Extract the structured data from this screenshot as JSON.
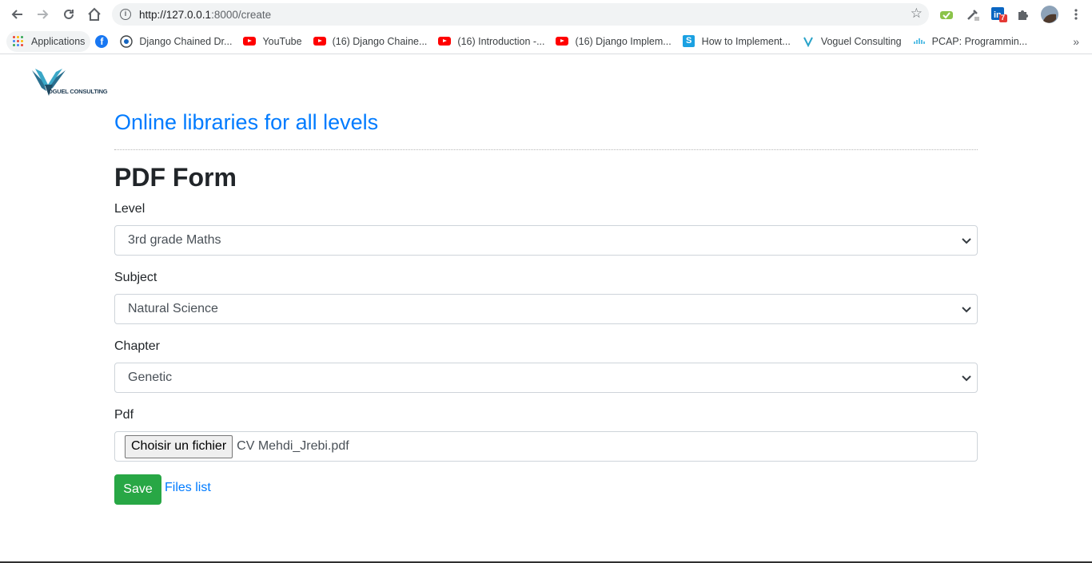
{
  "browser": {
    "url_host": "http://127.0.0.1",
    "url_path": ":8000/create",
    "linkedin_badge": "7",
    "bookmarks": [
      {
        "label": "Applications",
        "icon": "apps-grid-icon"
      },
      {
        "label": "",
        "icon": "facebook-icon"
      },
      {
        "label": "Django Chained Dr...",
        "icon": "django-icon"
      },
      {
        "label": "YouTube",
        "icon": "youtube-icon"
      },
      {
        "label": "(16) Django Chaine...",
        "icon": "youtube-icon"
      },
      {
        "label": "(16) Introduction -...",
        "icon": "youtube-icon"
      },
      {
        "label": "(16) Django Implem...",
        "icon": "youtube-icon"
      },
      {
        "label": "How to Implement...",
        "icon": "stackoverflow-icon"
      },
      {
        "label": "Voguel Consulting",
        "icon": "voguel-icon"
      },
      {
        "label": "PCAP: Programmin...",
        "icon": "cisco-icon"
      }
    ],
    "more_bookmarks": "»"
  },
  "page": {
    "logo_text": "OGUEL CONSULTING",
    "site_title": "Online libraries for all levels",
    "form_title": "PDF Form",
    "level_label": "Level",
    "level_value": "3rd grade Maths",
    "subject_label": "Subject",
    "subject_value": "Natural Science",
    "chapter_label": "Chapter",
    "chapter_value": "Genetic",
    "pdf_label": "Pdf",
    "file_button": "Choisir un fichier",
    "file_name": "CV Mehdi_Jrebi.pdf",
    "save_label": "Save",
    "files_list_label": "Files list"
  },
  "colors": {
    "link": "#007bff",
    "save": "#28a745",
    "youtube": "#ff0000"
  }
}
